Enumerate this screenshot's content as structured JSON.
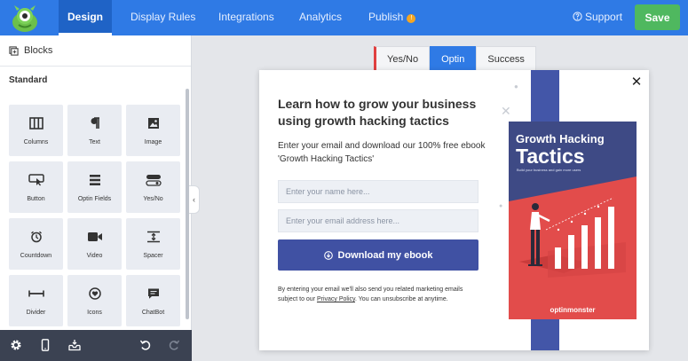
{
  "topbar": {
    "nav": [
      {
        "label": "Design",
        "active": true
      },
      {
        "label": "Display Rules",
        "active": false
      },
      {
        "label": "Integrations",
        "active": false
      },
      {
        "label": "Analytics",
        "active": false
      },
      {
        "label": "Publish",
        "active": false
      }
    ],
    "publish_badge": "!",
    "support_label": "Support",
    "save_label": "Save"
  },
  "sidebar": {
    "header": "Blocks",
    "section_title": "Standard",
    "blocks": [
      {
        "label": "Columns",
        "icon": "columns-icon"
      },
      {
        "label": "Text",
        "icon": "pilcrow-icon"
      },
      {
        "label": "Image",
        "icon": "image-icon"
      },
      {
        "label": "Button",
        "icon": "button-cursor-icon"
      },
      {
        "label": "Optin Fields",
        "icon": "form-fields-icon"
      },
      {
        "label": "Yes/No",
        "icon": "toggle-icon"
      },
      {
        "label": "Countdown",
        "icon": "alarm-clock-icon"
      },
      {
        "label": "Video",
        "icon": "video-camera-icon"
      },
      {
        "label": "Spacer",
        "icon": "spacer-icon"
      },
      {
        "label": "Divider",
        "icon": "divider-icon"
      },
      {
        "label": "Icons",
        "icon": "heart-circle-icon"
      },
      {
        "label": "ChatBot",
        "icon": "chat-icon"
      }
    ],
    "collapse_glyph": "‹"
  },
  "view_tabs": [
    {
      "label": "Yes/No",
      "active": false
    },
    {
      "label": "Optin",
      "active": true
    },
    {
      "label": "Success",
      "active": false
    }
  ],
  "popup": {
    "headline": "Learn how to grow your business using growth hacking tactics",
    "subtext": "Enter your email and download our 100% free ebook 'Growth Hacking Tactics'",
    "name_placeholder": "Enter your name here...",
    "email_placeholder": "Enter your email address here...",
    "cta_label": "Download my ebook",
    "disclaimer_before": "By entering your email we'll also send you related marketing emails subject to our ",
    "disclaimer_link": "Privacy Policy",
    "disclaimer_after": ". You can unsubscribe at anytime.",
    "close_glyph": "✕",
    "ebook": {
      "title_line1": "Growth Hacking",
      "title_line2": "Tactics",
      "subtitle": "Build your business and gain more users",
      "brand": "optinmonster"
    }
  },
  "colors": {
    "accent": "#2f7ae5",
    "save": "#4fb85f",
    "cta": "#4051a3",
    "ebook_red": "#e24c4b",
    "ebook_navy": "#3e4a85"
  }
}
